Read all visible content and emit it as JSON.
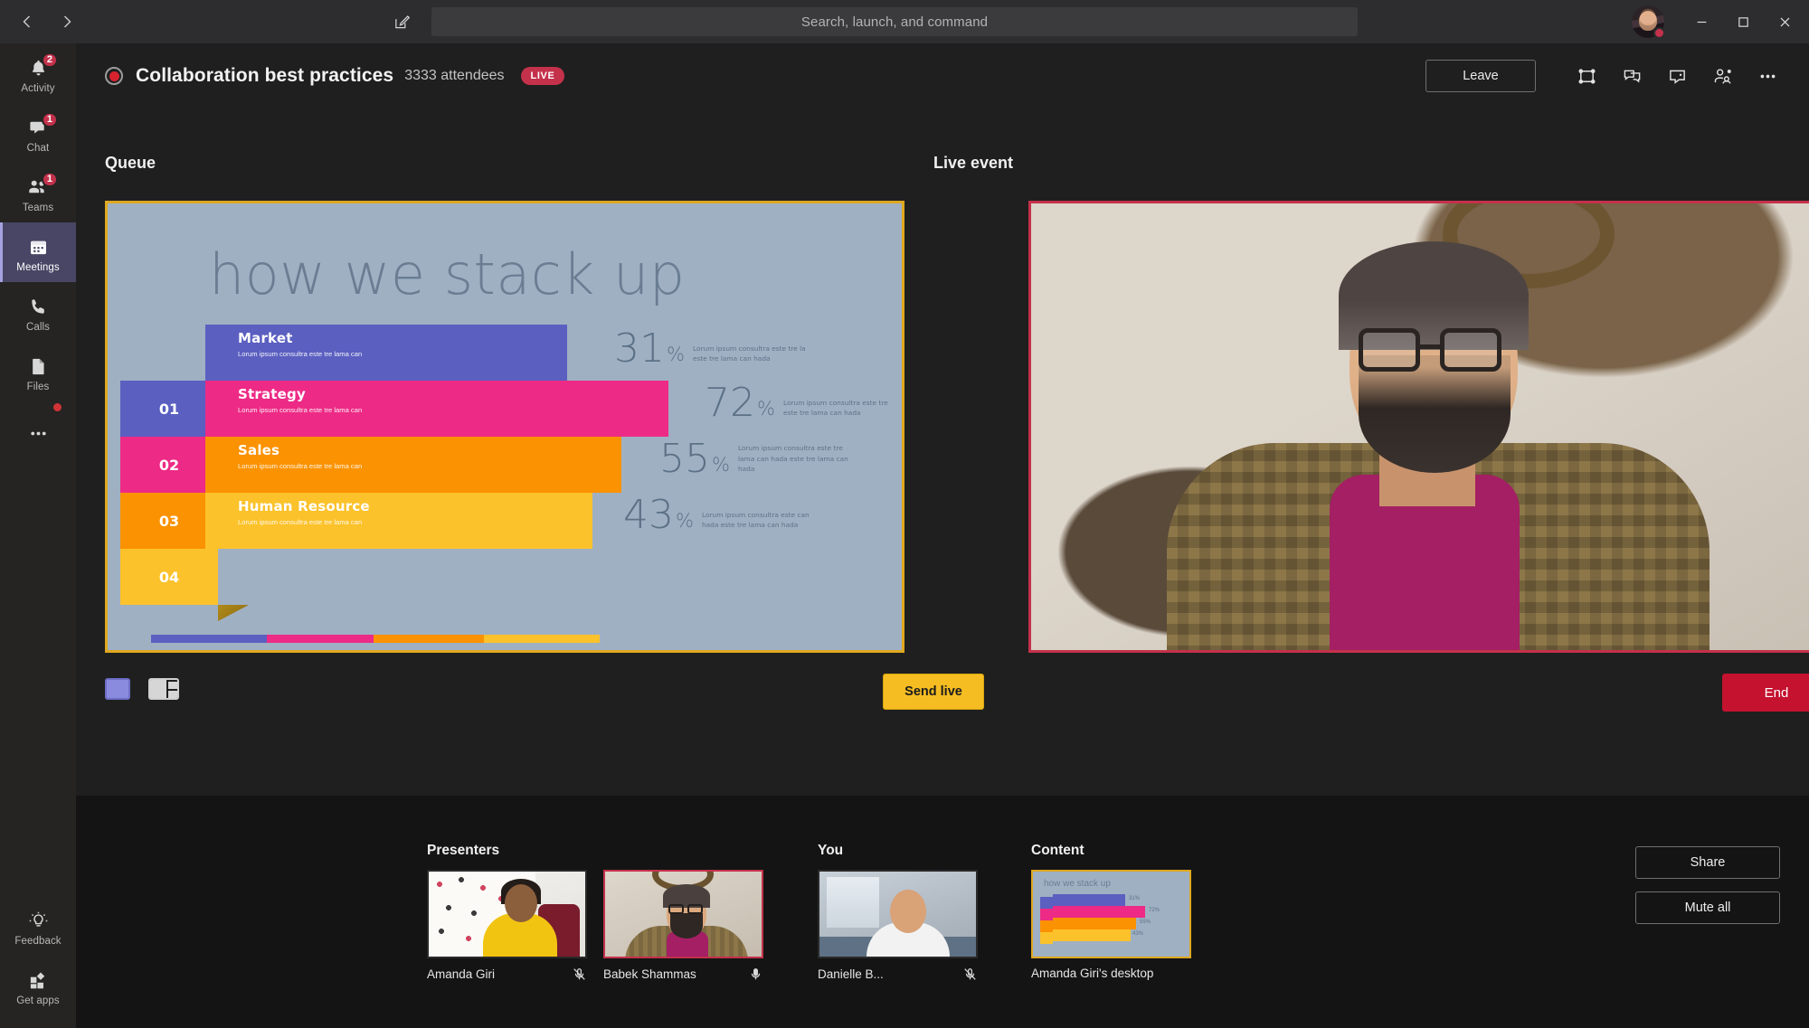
{
  "window": {
    "search_placeholder": "Search, launch, and command",
    "back_icon": "chevron-left-icon",
    "forward_icon": "chevron-right-icon",
    "compose_icon": "compose-icon",
    "minimize_label": "Minimize",
    "maximize_label": "Maximize",
    "close_label": "Close"
  },
  "rail": {
    "items": [
      {
        "label": "Activity",
        "icon": "bell-icon",
        "badge": "2",
        "active": false
      },
      {
        "label": "Chat",
        "icon": "chat-icon",
        "badge": "1",
        "active": false
      },
      {
        "label": "Teams",
        "icon": "people-icon",
        "badge": "1",
        "active": false
      },
      {
        "label": "Meetings",
        "icon": "calendar-icon",
        "badge": "",
        "active": true
      },
      {
        "label": "Calls",
        "icon": "phone-icon",
        "badge": "",
        "active": false
      },
      {
        "label": "Files",
        "icon": "file-icon",
        "badge": "",
        "active": false
      },
      {
        "label": "",
        "icon": "more-icon",
        "badge": "",
        "active": false
      }
    ],
    "bottom": [
      {
        "label": "Feedback",
        "icon": "lightbulb-icon"
      },
      {
        "label": "Get apps",
        "icon": "apps-grid-icon"
      }
    ]
  },
  "meeting": {
    "title": "Collaboration best practices",
    "attendees": "3333 attendees",
    "live_badge": "LIVE",
    "recording_icon": "record-dot-icon",
    "leave_label": "Leave",
    "header_icons": [
      {
        "name": "fullscreen-icon"
      },
      {
        "name": "qna-icon"
      },
      {
        "name": "chat-bubble-icon"
      },
      {
        "name": "add-people-icon"
      },
      {
        "name": "more-options-icon"
      }
    ]
  },
  "queue": {
    "label": "Queue",
    "border_color": "#dfa81f",
    "send_live_label": "Send live",
    "controls": [
      {
        "name": "slide-color-swatch",
        "color": "#8a8adf"
      },
      {
        "name": "layout-picker-icon"
      }
    ]
  },
  "live_event": {
    "label": "Live event",
    "border_color": "#c4314b",
    "end_label": "End"
  },
  "chart_data": {
    "type": "bar",
    "title": "how we stack up",
    "orientation": "horizontal",
    "categories": [
      "Market",
      "Strategy",
      "Sales",
      "Human Resource"
    ],
    "values": [
      31,
      72,
      55,
      43
    ],
    "value_suffix": "%",
    "indices": [
      "01",
      "02",
      "03",
      "04"
    ],
    "colors": [
      "#5b5fc0",
      "#ed2a86",
      "#fb9201",
      "#fcc22b"
    ],
    "blurbs": [
      "Lorum ipsum consultra este tre la este tre lama can hada",
      "Lorum ipsum consultra este tre este tre lama can hada",
      "Lorum ipsum consultra este tre lama can hada este tre lama can hada",
      "Lorum ipsum consultra este can hada este tre lama can hada"
    ],
    "sub_blurb": "Lorum ipsum consultra este tre lama can",
    "xlabel": "",
    "ylabel": "",
    "legend": false,
    "grid": false
  },
  "tray": {
    "presenters_label": "Presenters",
    "you_label": "You",
    "content_label": "Content",
    "presenters": [
      {
        "name": "Amanda Giri",
        "mic": "mic-muted-icon",
        "selected": false
      },
      {
        "name": "Babek Shammas",
        "mic": "mic-on-icon",
        "selected": true
      }
    ],
    "you": [
      {
        "name": "Danielle B...",
        "mic": "mic-muted-icon",
        "selected": false
      }
    ],
    "content": [
      {
        "name": "Amanda Giri's desktop",
        "selected": true
      }
    ],
    "actions": [
      {
        "label": "Share"
      },
      {
        "label": "Mute all"
      }
    ]
  }
}
